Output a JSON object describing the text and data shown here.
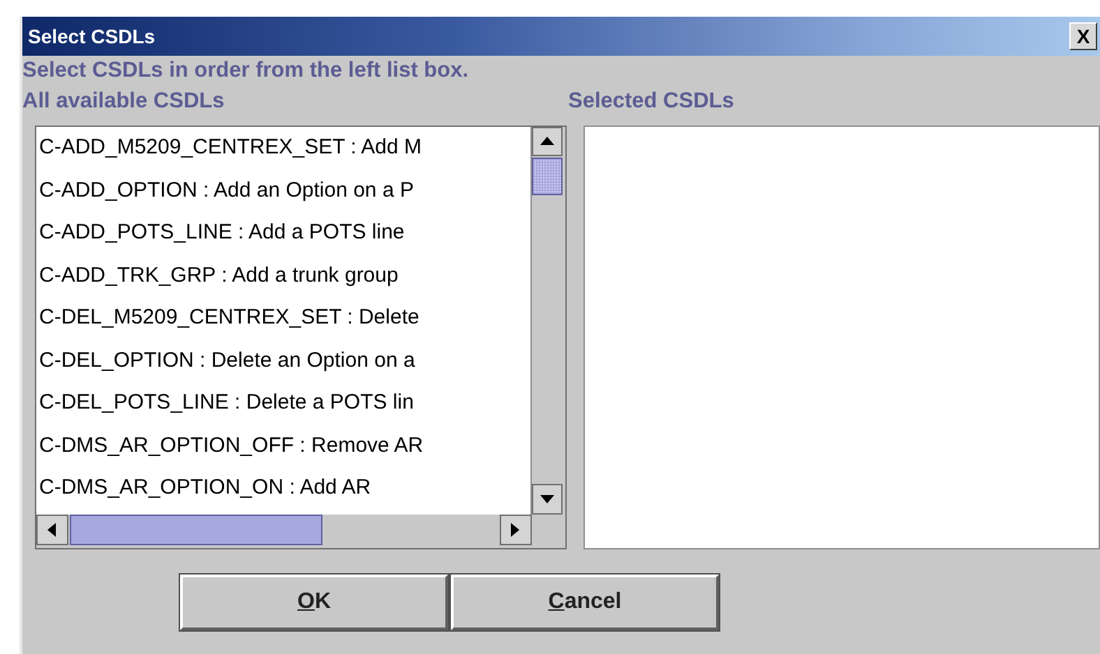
{
  "window": {
    "title": "Select CSDLs",
    "close": "X"
  },
  "instruction": "Select CSDLs in order from the left list box.",
  "available": {
    "label": "All available CSDLs",
    "items": [
      {
        "text": "C-ADD_M5209_CENTREX_SET : Add M"
      },
      {
        "text": "C-ADD_OPTION : Add an Option on a P"
      },
      {
        "text": "C-ADD_POTS_LINE : Add a POTS line"
      },
      {
        "text": "C-ADD_TRK_GRP : Add a trunk group"
      },
      {
        "text": "C-DEL_M5209_CENTREX_SET : Delete"
      },
      {
        "text": "C-DEL_OPTION : Delete an Option on a"
      },
      {
        "text": "C-DEL_POTS_LINE : Delete a POTS lin"
      },
      {
        "text": "C-DMS_AR_OPTION_OFF : Remove AR"
      },
      {
        "text": "C-DMS_AR_OPTION_ON : Add AR"
      }
    ]
  },
  "selected": {
    "label": "Selected CSDLs"
  },
  "buttons": [
    {
      "label": "OK"
    },
    {
      "label": "Cancel"
    }
  ]
}
